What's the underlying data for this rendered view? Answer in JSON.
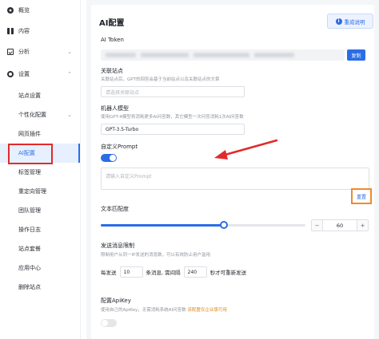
{
  "sidebar": {
    "top_items": [
      {
        "label": "概览",
        "icon": "overview-icon"
      },
      {
        "label": "内容",
        "icon": "content-icon"
      },
      {
        "label": "分析",
        "icon": "analysis-icon"
      },
      {
        "label": "设置",
        "icon": "settings-icon"
      }
    ],
    "sub_items": [
      {
        "label": "站点设置"
      },
      {
        "label": "个性化配置"
      },
      {
        "label": "网页插件"
      },
      {
        "label": "AI配置"
      },
      {
        "label": "标签管理"
      },
      {
        "label": "重定向管理"
      },
      {
        "label": "团队管理"
      },
      {
        "label": "操作日志"
      },
      {
        "label": "站点套餐"
      },
      {
        "label": "应用中心"
      },
      {
        "label": "删除站点"
      }
    ]
  },
  "page": {
    "title": "AI配置",
    "help_label": "重成说明"
  },
  "ai_token": {
    "label": "AI Token",
    "copy_label": "复制"
  },
  "site_link": {
    "label": "关联站点",
    "hint": "关联站点后，GPT的回答会基于当前站点以及关联站点的文章",
    "placeholder": "请选择关联站点"
  },
  "robot_model": {
    "label": "机器人模型",
    "hint": "使用GPT-4模型将消耗更多AI问答数，其它模型一次问答消耗1次AI问答数",
    "value": "GPT-3.5-Turbo"
  },
  "custom_prompt": {
    "label": "自定义Prompt",
    "enabled": true,
    "placeholder": "请输入自定义Prompt",
    "reset_label": "重置"
  },
  "text_match": {
    "label": "文本匹配度",
    "value": "60",
    "value_fraction": 0.6
  },
  "rate_limit": {
    "label": "发送消息限制",
    "hint": "限制用户从同一IP发送的消息数，可以有效防止用户滥用",
    "prefix": "每发送",
    "count": "10",
    "middle": "条消息, 需间隔",
    "interval": "240",
    "suffix": "秒才可重新发送"
  },
  "apikey": {
    "label": "配置ApiKey",
    "hint": "使用自己的ApiKey，无需消耗系统AI问答数",
    "link": "该配置仅企业版可用",
    "enabled": false
  },
  "colors": {
    "accent": "#2b6de5",
    "annotation_red": "#e02b2b",
    "annotation_orange": "#f08a2c"
  }
}
